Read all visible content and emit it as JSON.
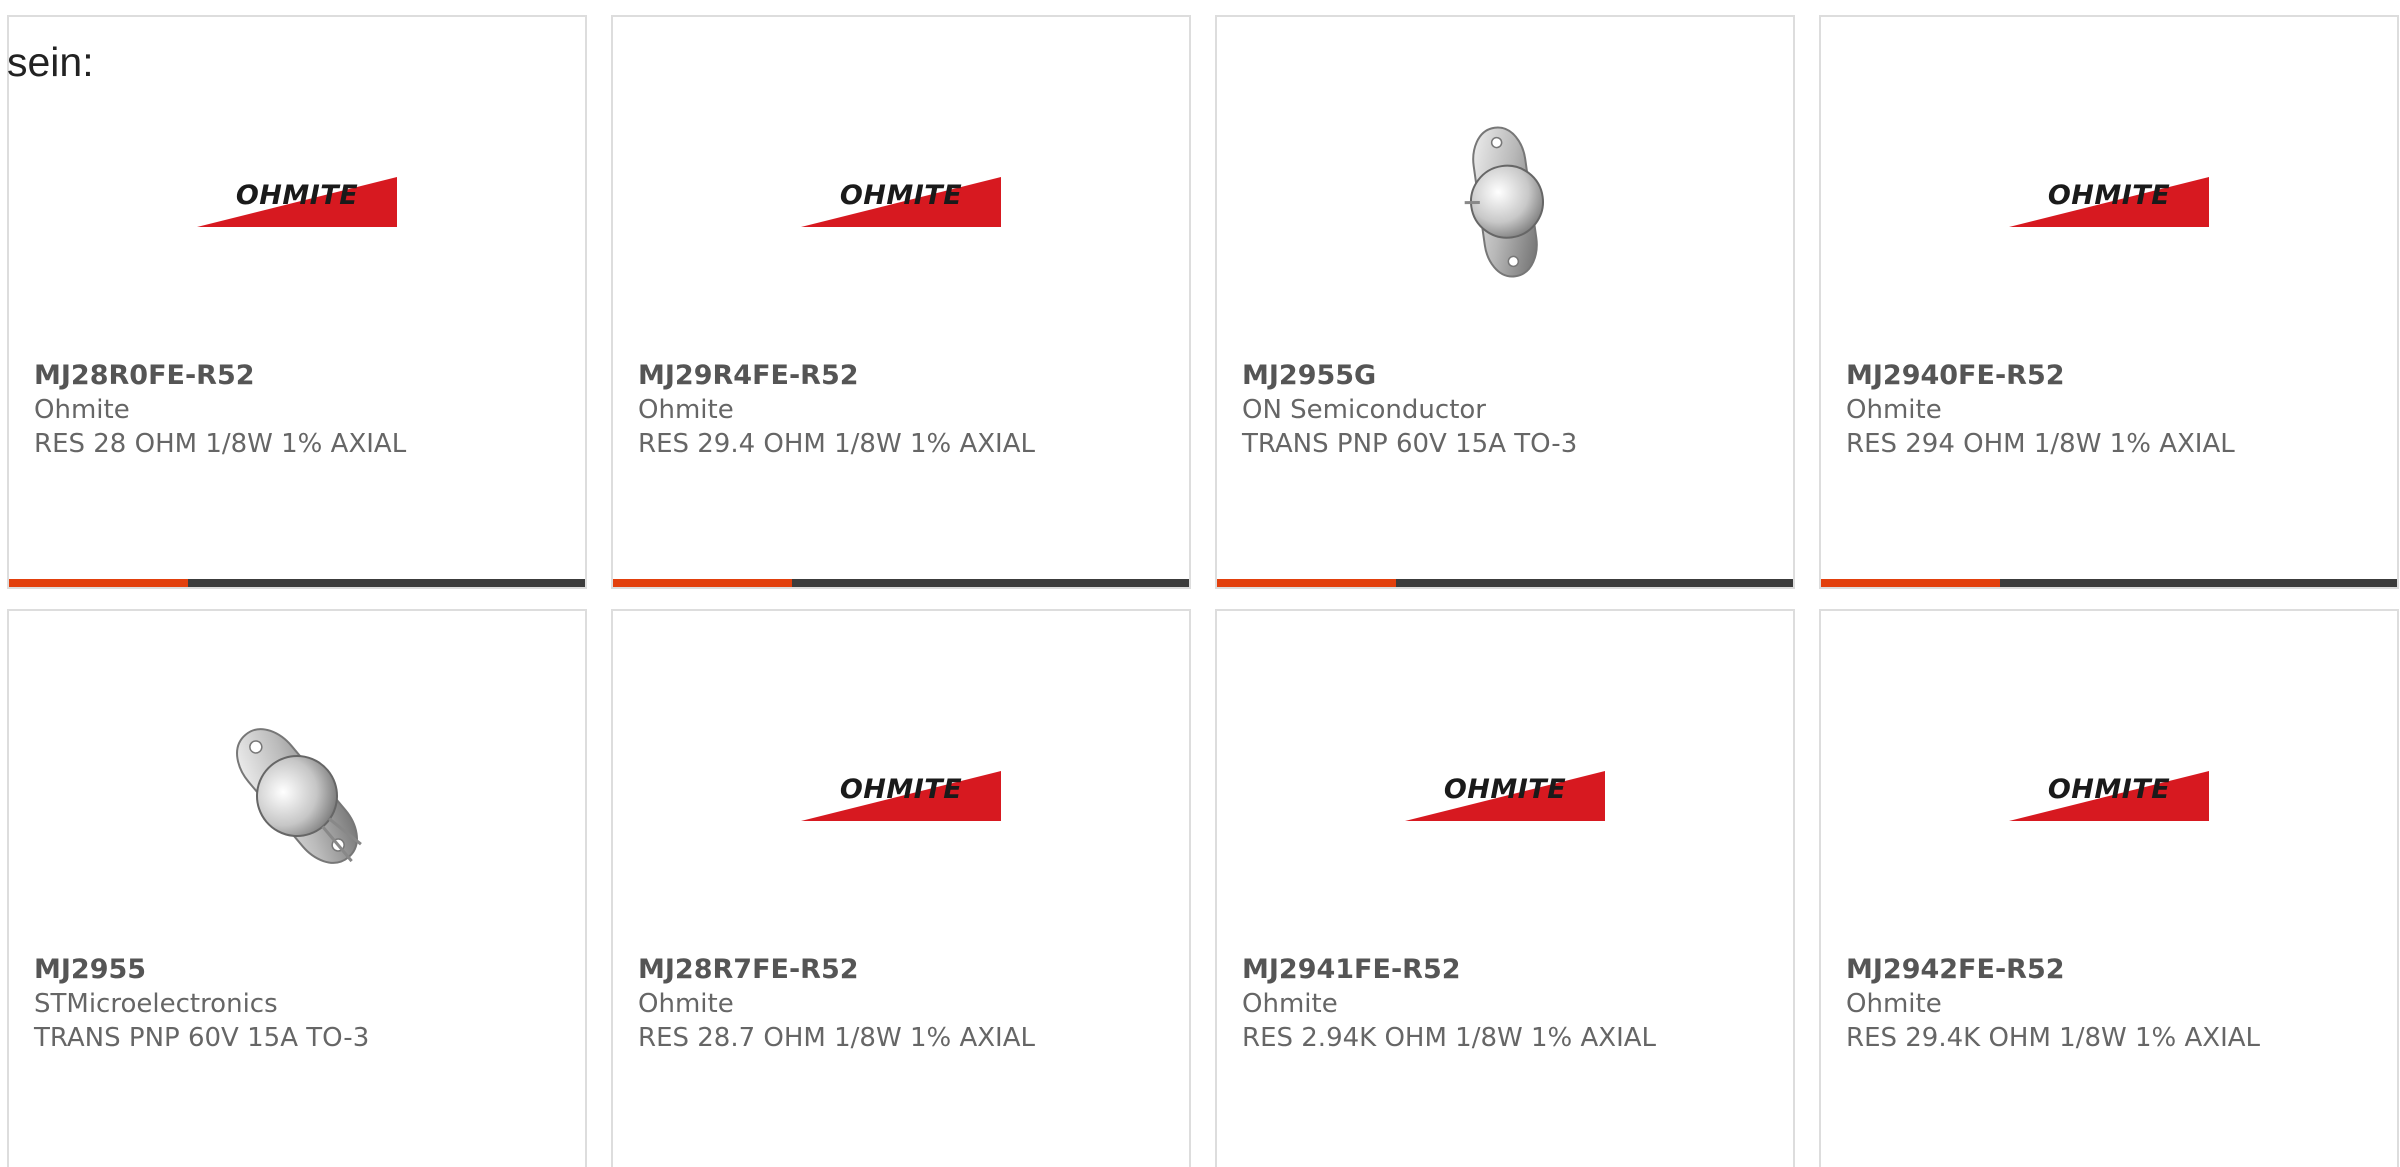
{
  "heading": "sein:",
  "colors": {
    "accent_bar": "#e2400d",
    "bar_track": "#3c3c3c",
    "ohmite_red": "#d71920",
    "card_border": "#dddddd"
  },
  "logo_text": "OHMITE",
  "products": [
    {
      "part": "MJ28R0FE-R52",
      "manufacturer": "Ohmite",
      "description": "RES 28 OHM 1/8W 1% AXIAL",
      "image": "ohmite-logo",
      "progress": 0.31
    },
    {
      "part": "MJ29R4FE-R52",
      "manufacturer": "Ohmite",
      "description": "RES 29.4 OHM 1/8W 1% AXIAL",
      "image": "ohmite-logo",
      "progress": 0.31
    },
    {
      "part": "MJ2955G",
      "manufacturer": "ON Semiconductor",
      "description": "TRANS PNP 60V 15A TO-3",
      "image": "to3-transistor",
      "progress": 0.31
    },
    {
      "part": "MJ2940FE-R52",
      "manufacturer": "Ohmite",
      "description": "RES 294 OHM 1/8W 1% AXIAL",
      "image": "ohmite-logo",
      "progress": 0.31
    },
    {
      "part": "MJ2955",
      "manufacturer": "STMicroelectronics",
      "description": "TRANS PNP 60V 15A TO-3",
      "image": "to3-transistor",
      "progress": null
    },
    {
      "part": "MJ28R7FE-R52",
      "manufacturer": "Ohmite",
      "description": "RES 28.7 OHM 1/8W 1% AXIAL",
      "image": "ohmite-logo",
      "progress": null
    },
    {
      "part": "MJ2941FE-R52",
      "manufacturer": "Ohmite",
      "description": "RES 2.94K OHM 1/8W 1% AXIAL",
      "image": "ohmite-logo",
      "progress": null
    },
    {
      "part": "MJ2942FE-R52",
      "manufacturer": "Ohmite",
      "description": "RES 29.4K OHM 1/8W 1% AXIAL",
      "image": "ohmite-logo",
      "progress": null
    }
  ]
}
